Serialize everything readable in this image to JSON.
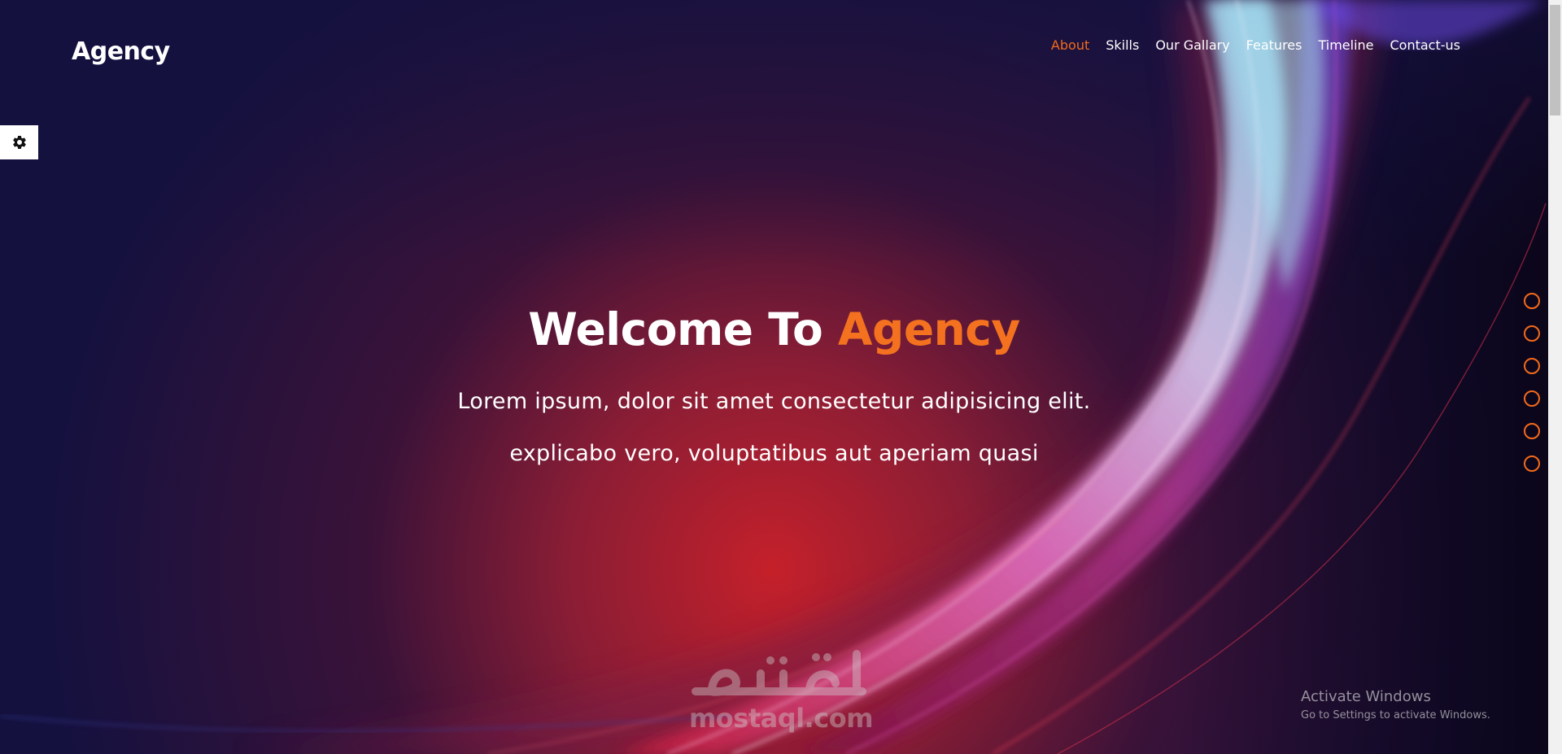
{
  "brand": "Agency",
  "nav": [
    {
      "label": "About",
      "active": true
    },
    {
      "label": "Skills",
      "active": false
    },
    {
      "label": "Our Gallary",
      "active": false
    },
    {
      "label": "Features",
      "active": false
    },
    {
      "label": "Timeline",
      "active": false
    },
    {
      "label": "Contact-us",
      "active": false
    }
  ],
  "settings": {
    "icon": "gear-icon"
  },
  "hero": {
    "title_main": "Welcome To",
    "title_accent": "Agency",
    "line1": "Lorem ipsum, dolor sit amet consectetur adipisicing elit.",
    "line2": "explicabo vero, voluptatibus aut aperiam quasi"
  },
  "bullets_count": 6,
  "watermark": {
    "arabic": "مستقل",
    "latin": "mostaql.com"
  },
  "activate": {
    "title": "Activate Windows",
    "subtitle": "Go to Settings to activate Windows."
  },
  "colors": {
    "accent": "#f26a1b",
    "nav_text": "#ffffff",
    "background_dark": "#13113f"
  }
}
